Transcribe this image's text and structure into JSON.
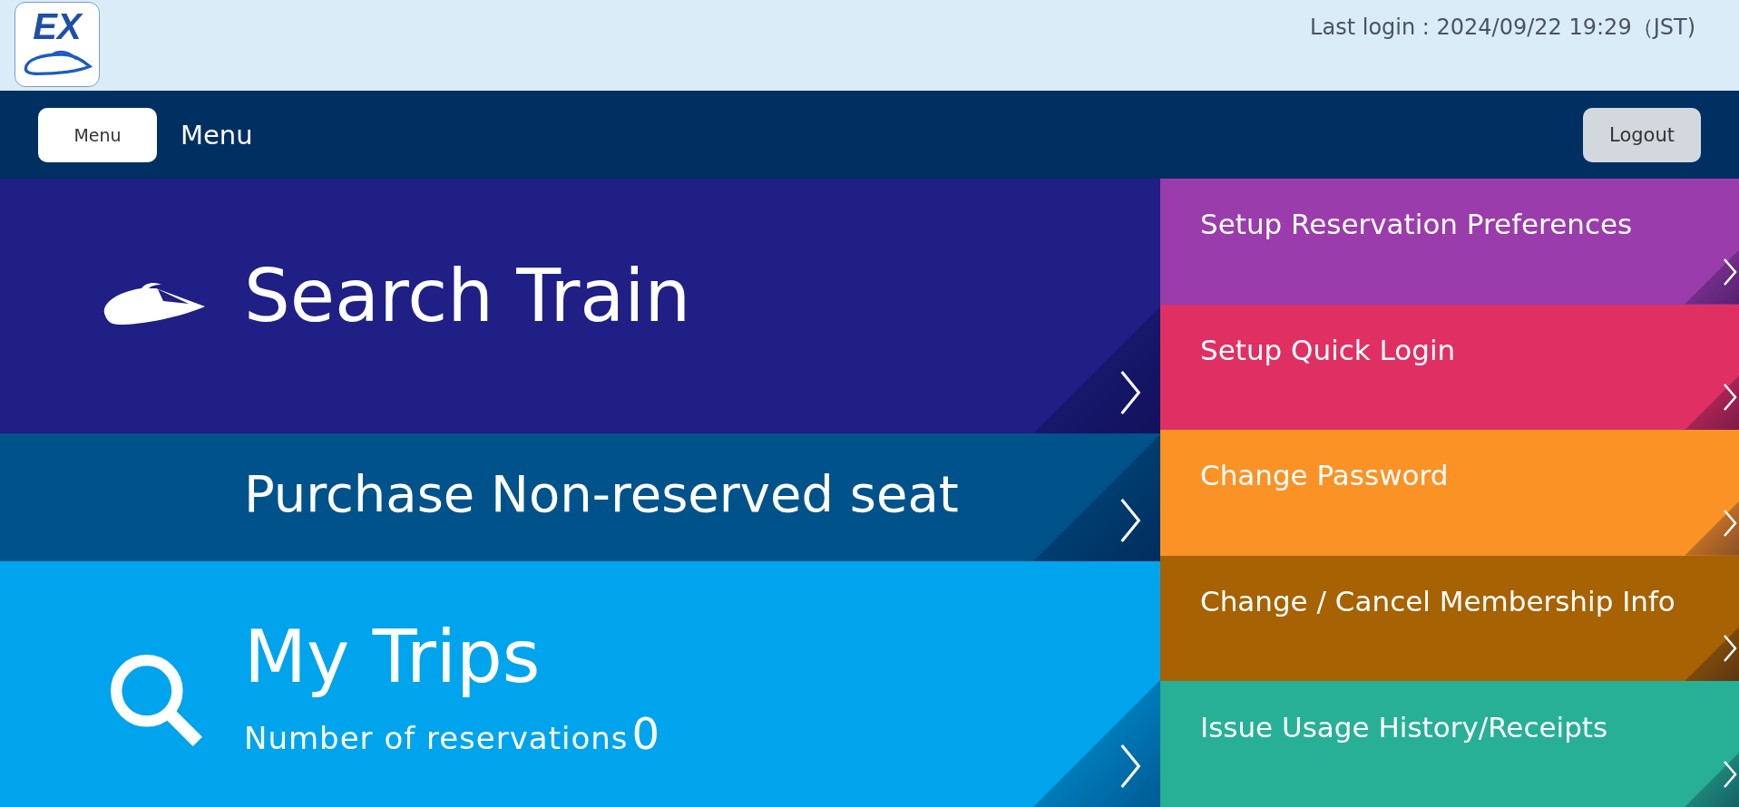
{
  "header": {
    "logo_text": "EX",
    "last_login": "Last login : 2024/09/22 19:29（JST)"
  },
  "nav": {
    "menu_button": "Menu",
    "menu_title": "Menu",
    "logout_button": "Logout"
  },
  "main_tiles": [
    {
      "kind": "train",
      "title": "Search Train",
      "color": "#1f1f85"
    },
    {
      "kind": "plain",
      "title": "Purchase Non-reserved seat",
      "color": "#00528a"
    },
    {
      "kind": "search",
      "title": "My Trips",
      "subtitle": "Number of reservations",
      "count": "0",
      "color": "#00a4ec"
    }
  ],
  "side_tiles": [
    {
      "label": "Setup Reservation Preferences",
      "color": "#9a3cab"
    },
    {
      "label": "Setup Quick Login",
      "color": "#e03063"
    },
    {
      "label": "Change Password",
      "color": "#fb9226"
    },
    {
      "label": "Change / Cancel Membership Info",
      "color": "#a66203"
    },
    {
      "label": "Issue Usage History/Receipts",
      "color": "#27b096"
    }
  ]
}
